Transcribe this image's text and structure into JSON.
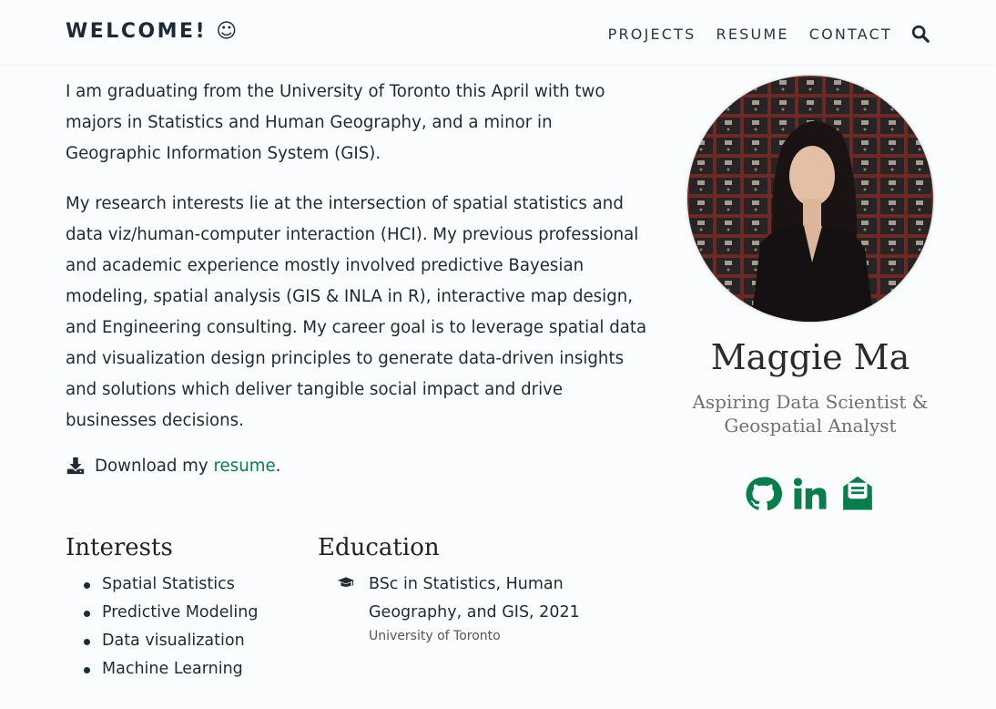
{
  "navbar": {
    "brand": "WELCOME! ☺",
    "links": [
      "PROJECTS",
      "RESUME",
      "CONTACT"
    ]
  },
  "bio": {
    "paragraph_1": "I am graduating from the University of Toronto this April with two majors in Statistics and Human Geography, and a minor in Geographic Information System (GIS).",
    "paragraph_2": "My research interests lie at the intersection of spatial statistics and data viz/human-computer interaction (HCI). My previous professional and academic experience mostly involved predictive Bayesian modeling, spatial analysis (GIS & INLA in R), interactive map design, and Engineering consulting. My career goal is to leverage spatial data and visualization design principles to generate data-driven insights and solutions which deliver tangible social impact and drive businesses decisions.",
    "download_prefix": "Download my ",
    "download_link": "resume",
    "download_suffix": "."
  },
  "interests": {
    "title": "Interests",
    "items": [
      "Spatial Statistics",
      "Predictive Modeling",
      "Data visualization",
      "Machine Learning"
    ]
  },
  "education": {
    "title": "Education",
    "degree": "BSc in Statistics, Human Geography, and GIS, 2021",
    "school": "University of Toronto"
  },
  "profile": {
    "name": "Maggie Ma",
    "role": "Aspiring Data Scientist & Geospatial Analyst"
  },
  "icons": {
    "search": "search-icon",
    "download": "download-icon",
    "graduation": "graduation-cap-icon",
    "social": [
      "github-icon",
      "linkedin-icon",
      "envelope-open-text-icon"
    ]
  },
  "colors": {
    "accent": "#0b7c4c",
    "text": "#1f2a33",
    "background": "#fbfcfd"
  }
}
